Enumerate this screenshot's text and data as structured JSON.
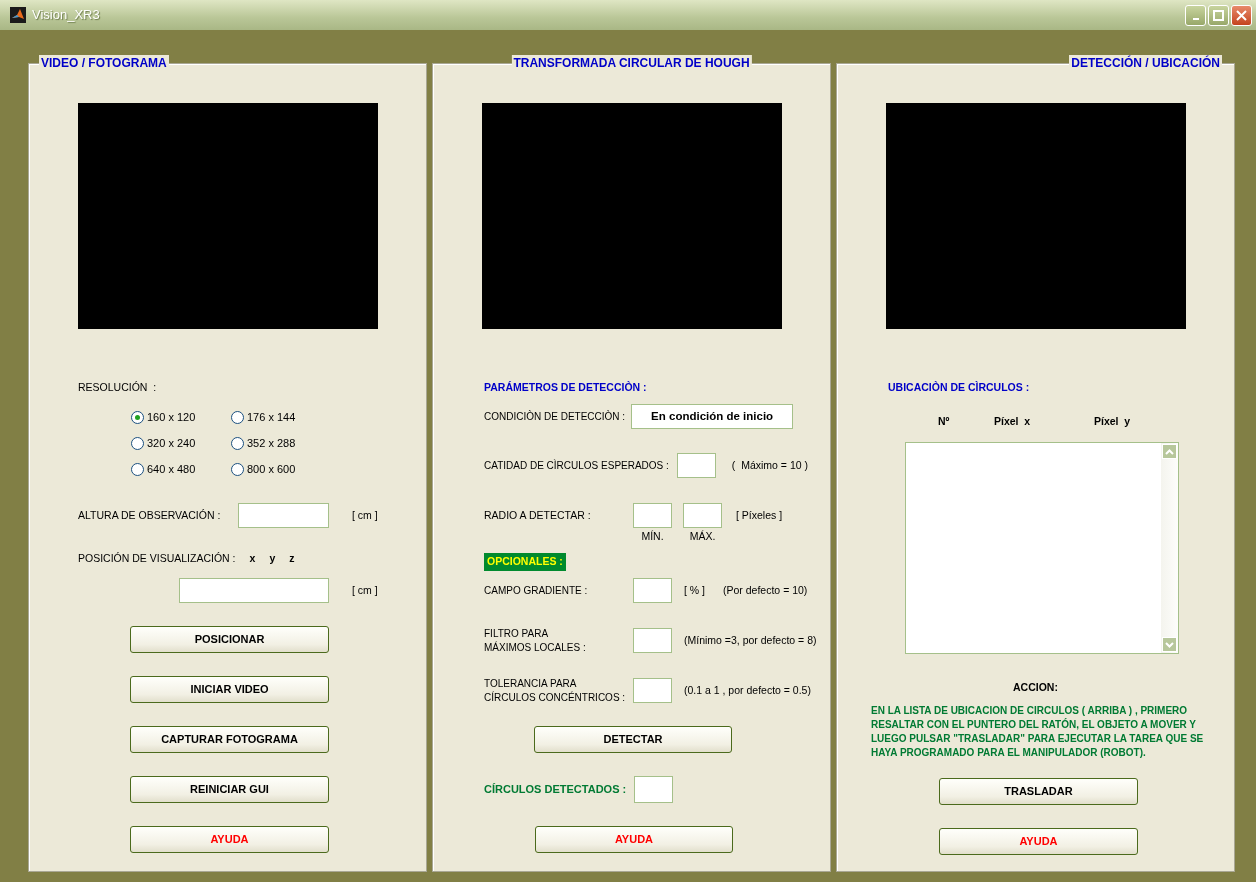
{
  "window": {
    "title": "Vision_XR3"
  },
  "video_panel": {
    "title": "VIDEO / FOTOGRAMA",
    "resolution_label": "RESOLUCIÓN  :",
    "resolutions": [
      {
        "label": "160 x 120",
        "selected": true
      },
      {
        "label": "176 x 144",
        "selected": false
      },
      {
        "label": "320 x 240",
        "selected": false
      },
      {
        "label": "352 x 288",
        "selected": false
      },
      {
        "label": "640 x 480",
        "selected": false
      },
      {
        "label": "800 x 600",
        "selected": false
      }
    ],
    "height_label": "ALTURA DE OBSERVACIÓN :",
    "height_unit": "[ cm ]",
    "position_label": "POSICIÓN DE VISUALIZACIÓN :",
    "axes": [
      "x",
      "y",
      "z"
    ],
    "position_unit": "[ cm ]",
    "buttons": [
      {
        "label": "POSICIONAR",
        "kind": "action"
      },
      {
        "label": "INICIAR  VIDEO",
        "kind": "action"
      },
      {
        "label": "CAPTURAR  FOTOGRAMA",
        "kind": "action"
      },
      {
        "label": "REINICIAR  GUI",
        "kind": "action"
      },
      {
        "label": "AYUDA",
        "kind": "help"
      }
    ]
  },
  "hough_panel": {
    "title": "TRANSFORMADA CIRCULAR DE HOUGH",
    "params_title": "PARÁMETROS DE DETECCIÒN :",
    "condition_label": "CONDICIÒN DE DETECCIÒN :",
    "condition_value": "En condición de inicio",
    "count_label": "CATIDAD DE CÌRCULOS ESPERADOS :",
    "count_hint": "(  Máximo = 10 )",
    "radius_label": "RADIO A DETECTAR :",
    "radius_unit": "[ Píxeles ]",
    "radius_min_label": "MÍN.",
    "radius_max_label": "MÁX.",
    "optional_badge": "OPCIONALES :",
    "optional_params": [
      {
        "label": "CAMPO GRADIENTE :",
        "unit": "[ % ]",
        "hint": "(Por defecto = 10)"
      },
      {
        "label": "FILTRO PARA\nMÁXIMOS LOCALES :",
        "hint": "(Mínimo =3, por defecto = 8)"
      },
      {
        "label": "TOLERANCIA PARA\nCÍRCULOS CONCÉNTRICOS :",
        "hint": "(0.1 a 1 , por defecto = 0.5)"
      }
    ],
    "detect_button": {
      "label": "DETECTAR",
      "kind": "action"
    },
    "detected_label": "CÍRCULOS DETECTADOS :",
    "help_button": {
      "label": "AYUDA",
      "kind": "help"
    }
  },
  "location_panel": {
    "title": "DETECCIÓN / UBICACIÓN",
    "list_title": "UBICACIÒN DE CÌRCULOS :",
    "columns": [
      "Nº",
      "Píxel  x",
      "Píxel  y"
    ],
    "action_title": "ACCION:",
    "action_text": "EN LA LISTA DE  UBICACION DE CIRCULOS  ( ARRIBA ) ,  PRIMERO RESALTAR CON EL PUNTERO DEL RATÓN, EL OBJETO A MOVER Y LUEGO PULSAR  \"TRASLADAR\"  PARA EJECUTAR LA TAREA QUE SE HAYA PROGRAMADO PARA EL MANIPULADOR (ROBOT).",
    "buttons": [
      {
        "label": "TRASLADAR",
        "kind": "action"
      },
      {
        "label": "AYUDA",
        "kind": "help"
      }
    ]
  }
}
